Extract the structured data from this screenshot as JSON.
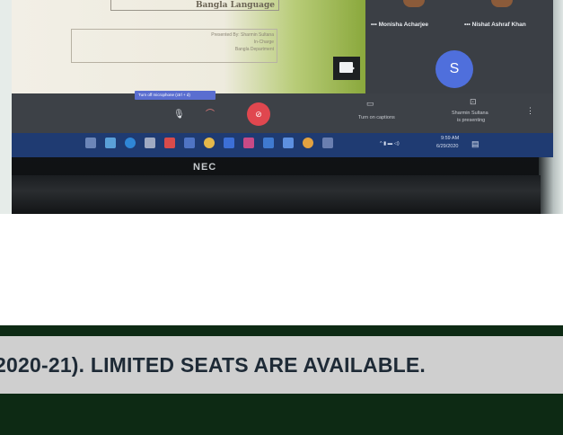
{
  "slide": {
    "title": "Bangla Language",
    "presented_by": "Presented By: Sharmin Sultana",
    "role": "In-Charge",
    "department": "Bangla Department"
  },
  "participants": [
    {
      "name": "Monisha Acharjee",
      "more_icon": "ellipsis-icon"
    },
    {
      "name": "Nishat Ashraf Khan",
      "more_icon": "ellipsis-icon"
    }
  ],
  "avatar_letter": "S",
  "controls": {
    "tooltip": "Turn off microphone (ctrl + d)",
    "captions_label": "Turn on captions",
    "presenter_line1": "Sharmin Sultana",
    "presenter_line2": "is presenting",
    "more_icon": "vertical-dots-icon"
  },
  "taskbar": {
    "time": "9:59 AM",
    "date": "6/29/2020"
  },
  "brand": "NEC",
  "banner": {
    "text": "2020-21). LIMITED SEATS ARE AVAILABLE."
  },
  "colors": {
    "banner_bg": "#0d2a14",
    "banner_strip": "#cfcfcf",
    "banner_text": "#1e2a36",
    "end_call": "#e0474f",
    "avatar": "#4f6fdc",
    "taskbar": "#1f3b72"
  }
}
